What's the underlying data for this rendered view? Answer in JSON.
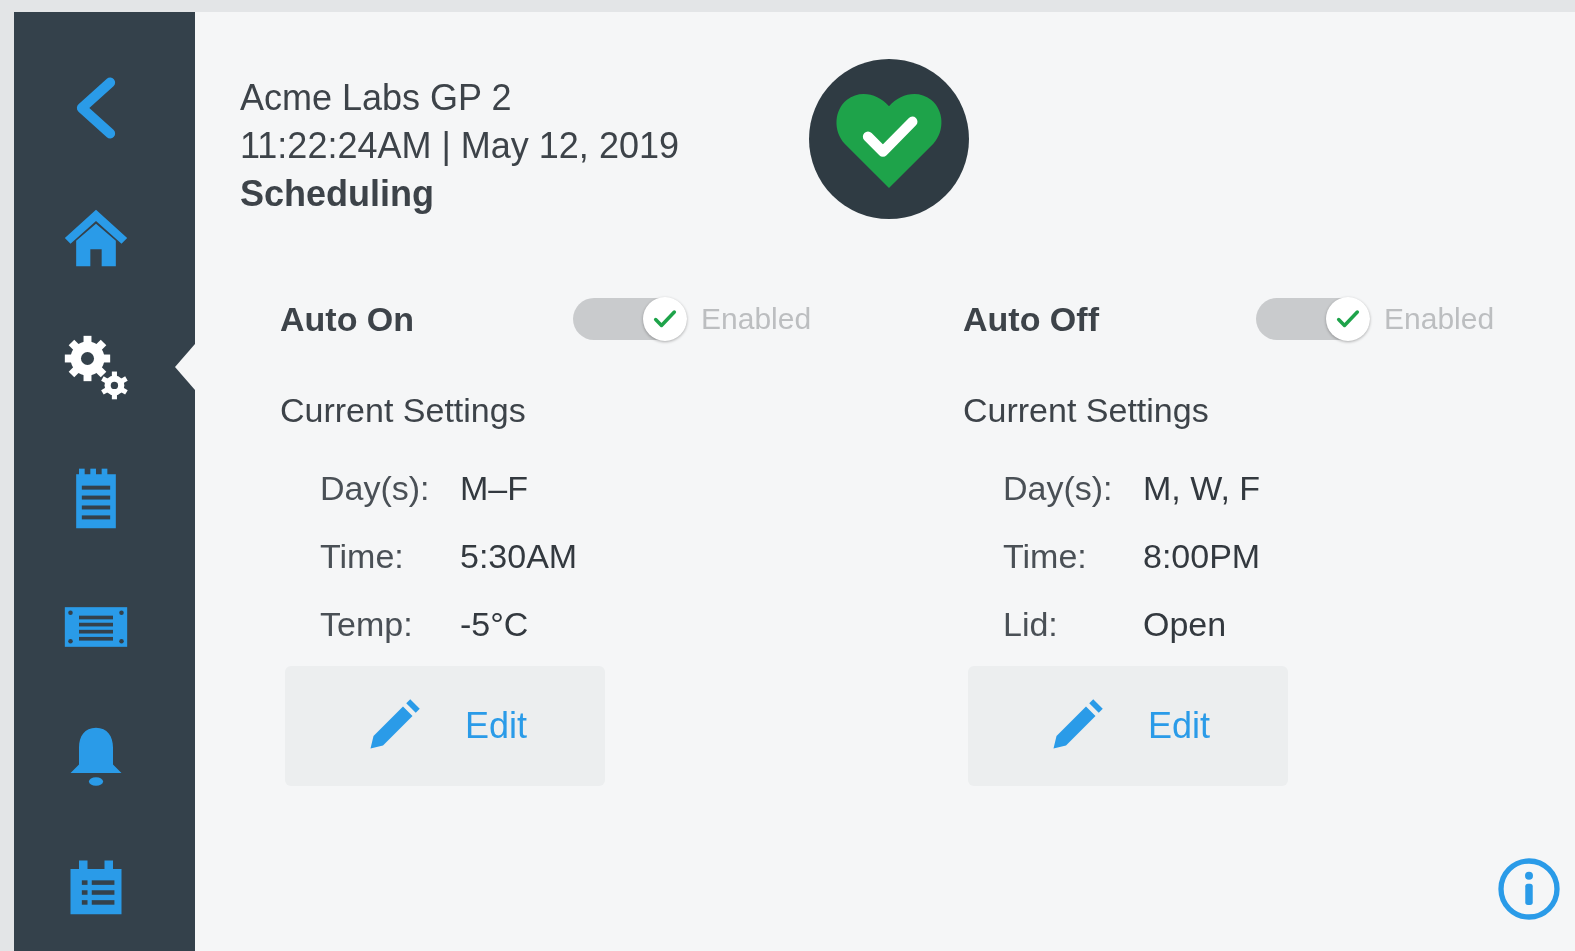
{
  "sidebar": {
    "items": [
      {
        "kind": "back",
        "selected": false
      },
      {
        "kind": "home",
        "selected": false
      },
      {
        "kind": "settings",
        "selected": true
      },
      {
        "kind": "notepad",
        "selected": false
      },
      {
        "kind": "panel",
        "selected": false
      },
      {
        "kind": "bell",
        "selected": false
      },
      {
        "kind": "calendar",
        "selected": false
      }
    ]
  },
  "header": {
    "device": "Acme Labs GP 2",
    "datetime": "11:22:24AM | May 12, 2019",
    "section": "Scheduling",
    "healthy": true
  },
  "schedules": [
    {
      "title": "Auto On",
      "on": true,
      "toggle_label": "Enabled",
      "subtitle": "Current Settings",
      "rows": [
        {
          "label": "Day(s):",
          "value": "M–F"
        },
        {
          "label": "Time:",
          "value": "5:30AM"
        },
        {
          "label": "Temp:",
          "value": "-5°C"
        }
      ],
      "button": "Edit"
    },
    {
      "title": "Auto Off",
      "on": true,
      "toggle_label": "Enabled",
      "subtitle": "Current Settings",
      "rows": [
        {
          "label": "Day(s):",
          "value": "M, W, F"
        },
        {
          "label": "Time:",
          "value": "8:00PM"
        },
        {
          "label": "Lid:",
          "value": "Open"
        }
      ],
      "button": "Edit"
    }
  ]
}
